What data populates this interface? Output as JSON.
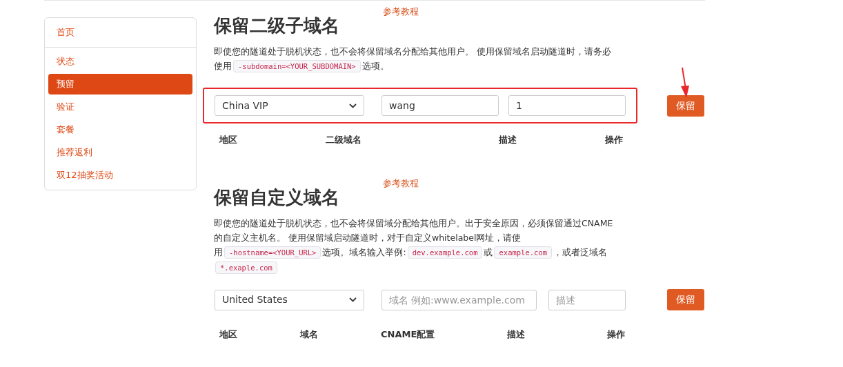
{
  "sidebar": {
    "items": [
      {
        "label": "首页",
        "selected": false
      },
      {
        "label": "状态",
        "selected": false
      },
      {
        "label": "预留",
        "selected": true
      },
      {
        "label": "验证",
        "selected": false
      },
      {
        "label": "套餐",
        "selected": false
      },
      {
        "label": "推荐返利",
        "selected": false
      },
      {
        "label": "双12抽奖活动",
        "selected": false
      }
    ]
  },
  "sections": [
    {
      "title": "保留二级子域名",
      "tutorial_link": "参考教程",
      "description": [
        {
          "kind": "text",
          "text": "即使您的隧道处于脱机状态，也不会将保留域名分配给其他用户。 使用保留域名启动隧道时，请务必使用"
        },
        {
          "kind": "code",
          "text": "-subdomain=<YOUR_SUBDOMAIN>"
        },
        {
          "kind": "text",
          "text": "选项。"
        }
      ],
      "highlighted": true,
      "form": {
        "region": "China VIP",
        "fields": [
          {
            "value": "wang"
          },
          {
            "value": "1"
          }
        ],
        "button": "保留"
      },
      "columns": [
        "地区",
        "二级域名",
        "描述",
        "操作"
      ]
    },
    {
      "title": "保留自定义域名",
      "tutorial_link": "参考教程",
      "description": [
        {
          "kind": "text",
          "text": "即使您的隧道处于脱机状态，也不会将保留域分配给其他用户。出于安全原因，必须保留通过CNAME的自定义主机名。 使用保留域启动隧道时，对于自定义whitelabel网址，请使用"
        },
        {
          "kind": "code",
          "text": "-hostname=<YOUR_URL>"
        },
        {
          "kind": "text",
          "text": "选项。域名输入举例:"
        },
        {
          "kind": "code",
          "text": "dev.example.com"
        },
        {
          "kind": "text",
          "text": "或"
        },
        {
          "kind": "code",
          "text": "example.com"
        },
        {
          "kind": "text",
          "text": "，或者泛域名"
        },
        {
          "kind": "code",
          "text": "*.exaple.com"
        }
      ],
      "highlighted": false,
      "form": {
        "region": "United States",
        "fields": [
          {
            "placeholder": "域名 例如:www.example.com"
          },
          {
            "placeholder": "描述"
          }
        ],
        "button": "保留"
      },
      "columns": [
        "地区",
        "域名",
        "CNAME配置",
        "描述",
        "操作"
      ]
    }
  ]
}
